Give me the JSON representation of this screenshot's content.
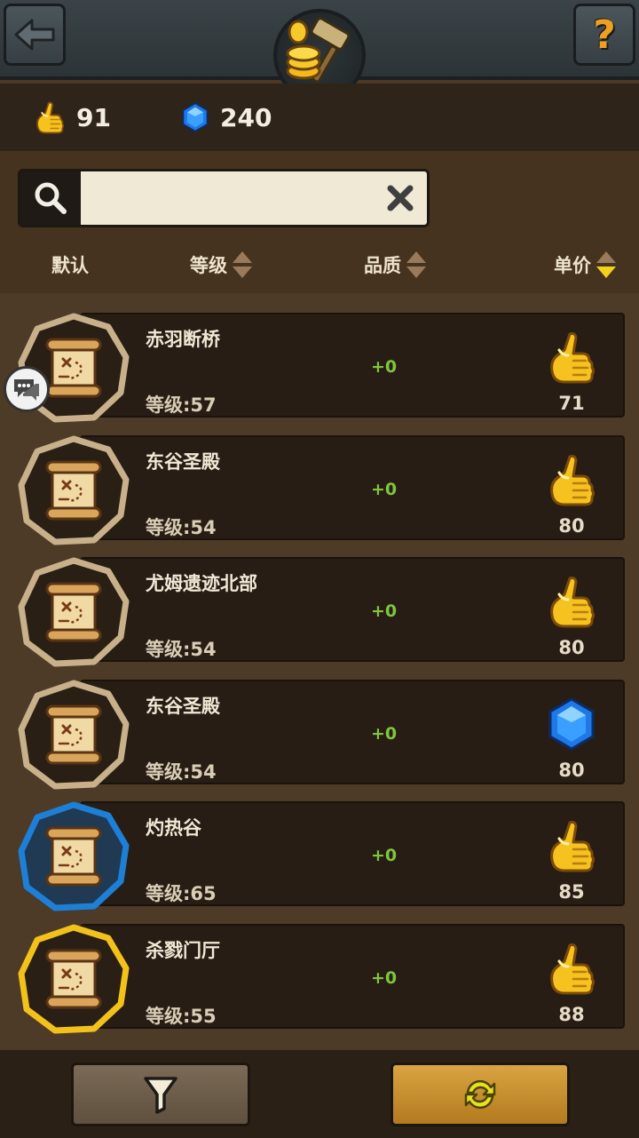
{
  "header": {
    "back_icon": "arrow-left-icon",
    "help_label": "?",
    "emblem_icon": "auction-hammer-coins-icon"
  },
  "currency": {
    "gold": "91",
    "gems": "240",
    "gold_icon": "gold-hand-icon",
    "gem_icon": "blue-gem-icon"
  },
  "search": {
    "placeholder": "",
    "value": ""
  },
  "sort": {
    "default_label": "默认",
    "level_label": "等级",
    "quality_label": "品质",
    "price_label": "单价"
  },
  "items": [
    {
      "name": "赤羽断桥",
      "level": "等级:57",
      "bonus": "+0",
      "price": "71",
      "currency": "gold",
      "quality": "common"
    },
    {
      "name": "东谷圣殿",
      "level": "等级:54",
      "bonus": "+0",
      "price": "80",
      "currency": "gold",
      "quality": "common"
    },
    {
      "name": "尤姆遗迹北部",
      "level": "等级:54",
      "bonus": "+0",
      "price": "80",
      "currency": "gold",
      "quality": "common"
    },
    {
      "name": "东谷圣殿",
      "level": "等级:54",
      "bonus": "+0",
      "price": "80",
      "currency": "gem",
      "quality": "common"
    },
    {
      "name": "灼热谷",
      "level": "等级:65",
      "bonus": "+0",
      "price": "85",
      "currency": "gold",
      "quality": "rare"
    },
    {
      "name": "杀戮门厅",
      "level": "等级:55",
      "bonus": "+0",
      "price": "88",
      "currency": "gold",
      "quality": "legendary"
    }
  ],
  "colors": {
    "common_ring": "#c8b08a",
    "rare_ring": "#1e7fd6",
    "legendary_ring": "#f2c21b",
    "bonus_green": "#7ec63c"
  },
  "bottom": {
    "filter_icon": "funnel-icon",
    "refresh_icon": "refresh-arrows-icon"
  }
}
